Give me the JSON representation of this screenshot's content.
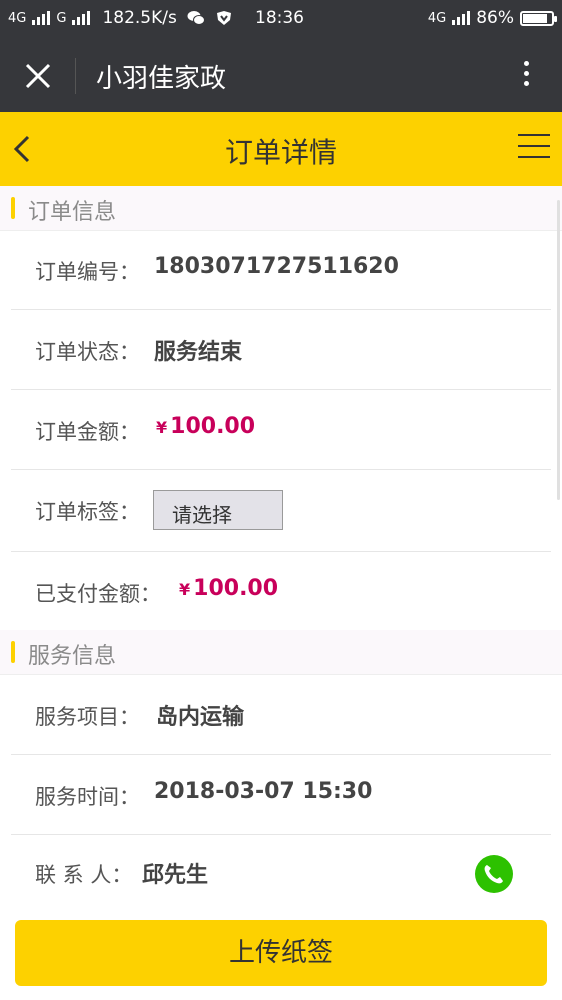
{
  "status_bar": {
    "network1": "4G",
    "network2": "G",
    "speed": "182.5K/s",
    "time": "18:36",
    "network3": "4G",
    "battery": "86%",
    "battery_level": 0.86
  },
  "wechat_bar": {
    "title": "小羽佳家政"
  },
  "header": {
    "title": "订单详情"
  },
  "order_info": {
    "section_title": "订单信息",
    "rows": [
      {
        "label": "订单编号：",
        "value": "1803071727511620"
      },
      {
        "label": "订单状态：",
        "value": "服务结束"
      },
      {
        "label": "订单金额：",
        "currency": "¥",
        "value": "100.00"
      },
      {
        "label": "订单标签：",
        "value": "请选择"
      },
      {
        "label": "已支付金额：",
        "currency": "¥",
        "value": "100.00"
      }
    ]
  },
  "service_info": {
    "section_title": "服务信息",
    "rows": [
      {
        "label": "服务项目：",
        "value": "岛内运输"
      },
      {
        "label": "服务时间：",
        "value": "2018-03-07 15:30"
      },
      {
        "label": "联 系 人：",
        "value": "邱先生"
      }
    ]
  },
  "bottom": {
    "upload_label": "上传纸签"
  },
  "colors": {
    "accent": "#fdd100",
    "price": "#c8005a",
    "dark_bar": "#36373b",
    "phone_green": "#2dc100"
  }
}
